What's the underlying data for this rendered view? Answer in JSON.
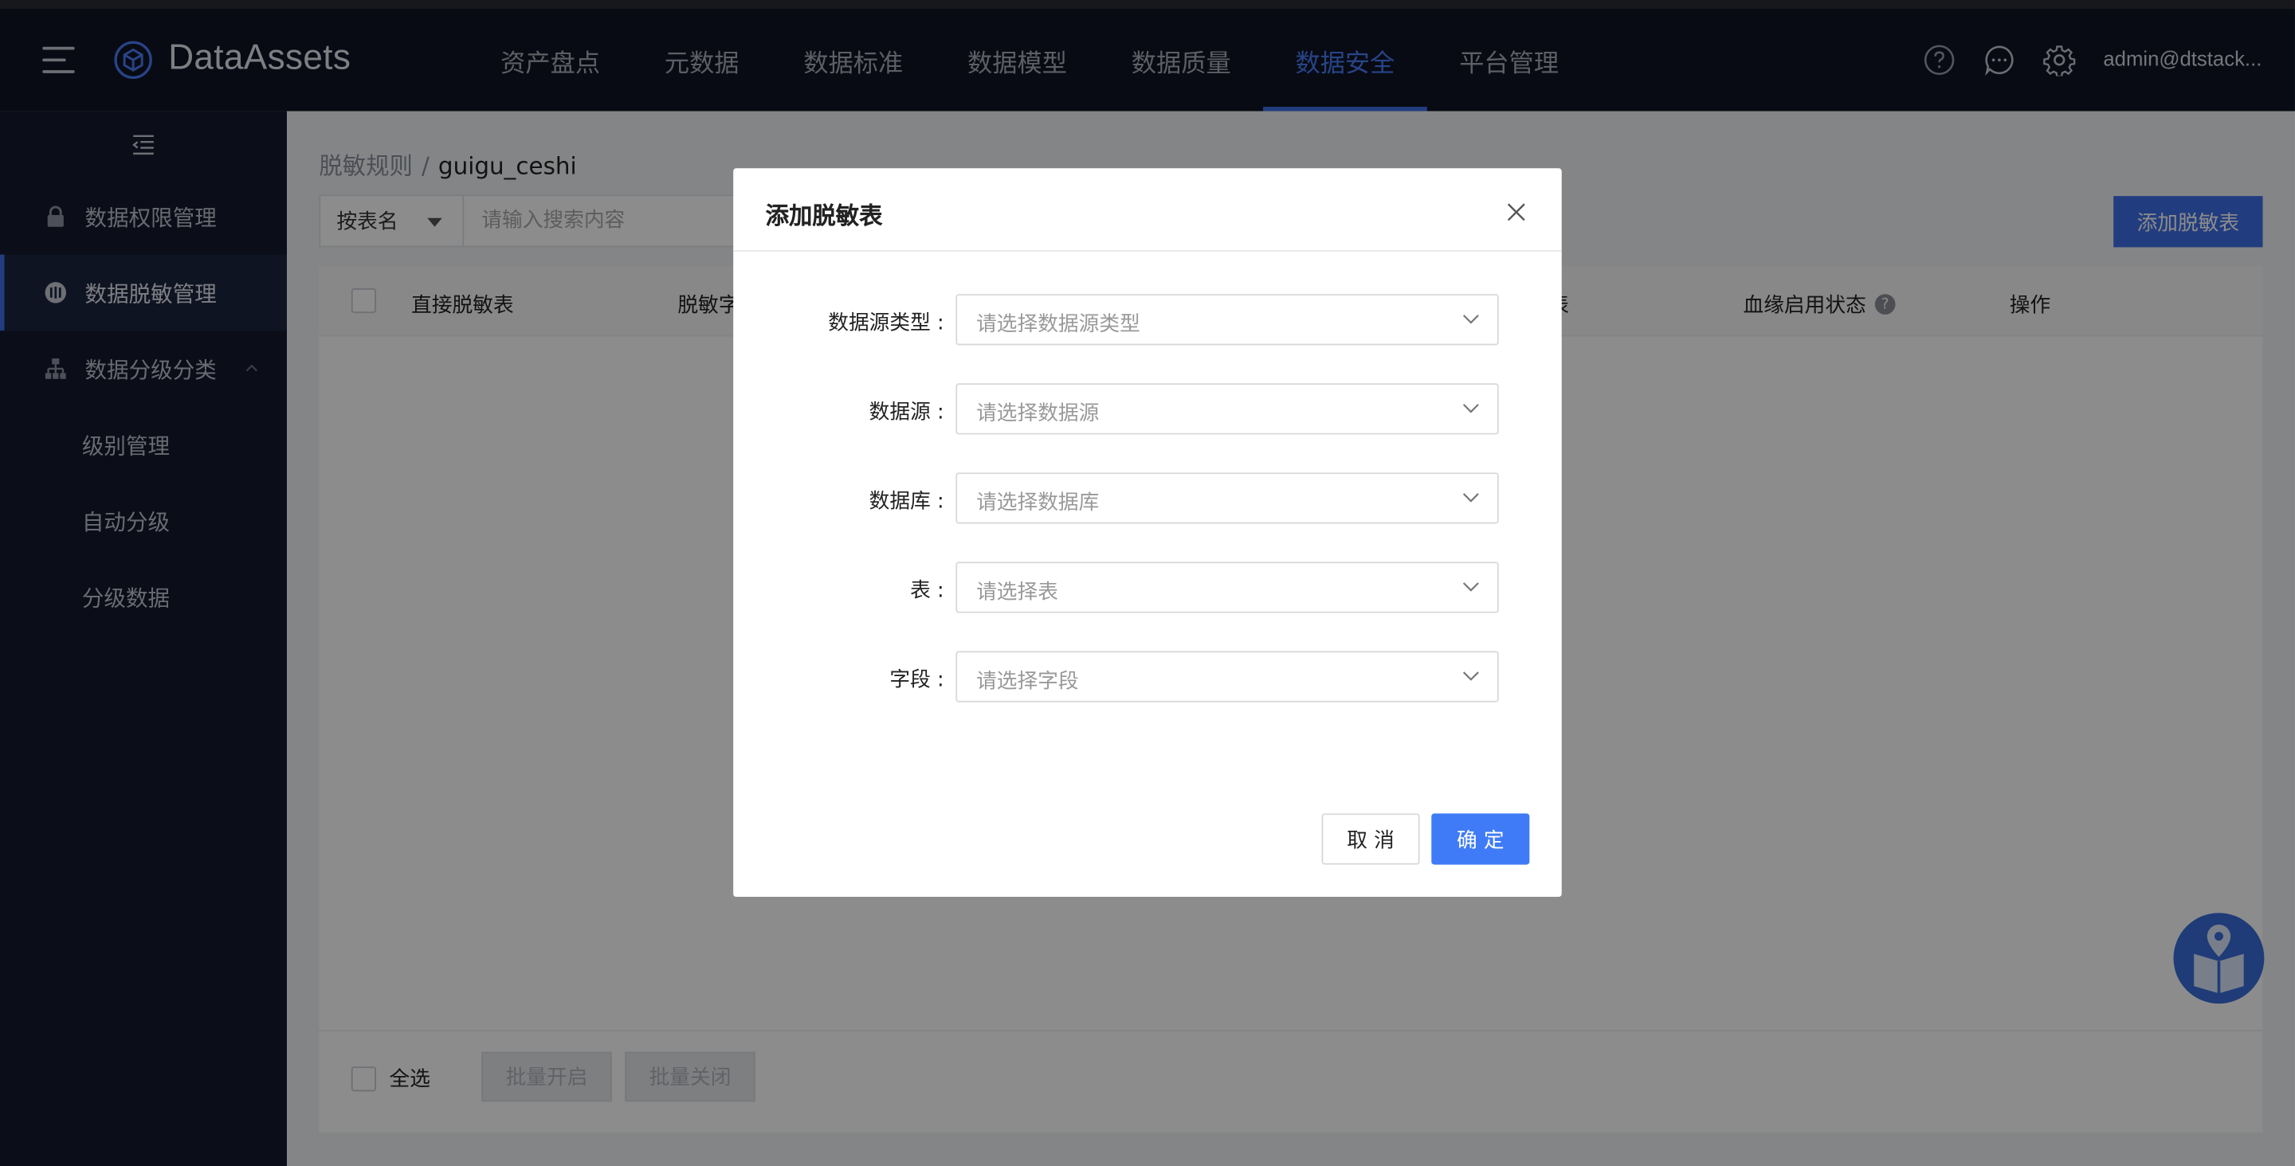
{
  "app": {
    "name": "DataAssets"
  },
  "nav": [
    "资产盘点",
    "元数据",
    "数据标准",
    "数据模型",
    "数据质量",
    "数据安全",
    "平台管理"
  ],
  "nav_active": "数据安全",
  "user": "admin@dtstack...",
  "icons": {
    "help": "help-icon",
    "message": "message-icon",
    "settings": "gear-icon"
  },
  "sidebar": {
    "items": [
      {
        "label": "数据权限管理",
        "icon": "lock-icon"
      },
      {
        "label": "数据脱敏管理",
        "icon": "mask-icon"
      },
      {
        "label": "数据分级分类",
        "icon": "hierarchy-icon"
      },
      {
        "label": "级别管理"
      },
      {
        "label": "自动分级"
      },
      {
        "label": "分级数据"
      }
    ]
  },
  "breadcrumb": {
    "parent": "脱敏规则",
    "separator": "/",
    "current": "guigu_ceshi"
  },
  "search": {
    "type": "按表名",
    "placeholder": "请输入搜索内容"
  },
  "add_button": "添加脱敏表",
  "table": {
    "columns": [
      "直接脱敏表",
      "脱敏字",
      "表",
      "血缘启用状态",
      "操作"
    ]
  },
  "footer": {
    "select_all": "全选",
    "batch_on": "批量开启",
    "batch_off": "批量关闭"
  },
  "modal": {
    "title": "添加脱敏表",
    "fields": [
      {
        "label": "数据源类型 :",
        "placeholder": "请选择数据源类型"
      },
      {
        "label": "数据源 :",
        "placeholder": "请选择数据源"
      },
      {
        "label": "数据库 :",
        "placeholder": "请选择数据库"
      },
      {
        "label": "表 :",
        "placeholder": "请选择表"
      },
      {
        "label": "字段 :",
        "placeholder": "请选择字段"
      }
    ],
    "cancel": "取 消",
    "ok": "确 定"
  },
  "colors": {
    "accent": "#3f6fe8",
    "header_bg": "#0f1426",
    "sidebar_bg": "#141a2e"
  }
}
